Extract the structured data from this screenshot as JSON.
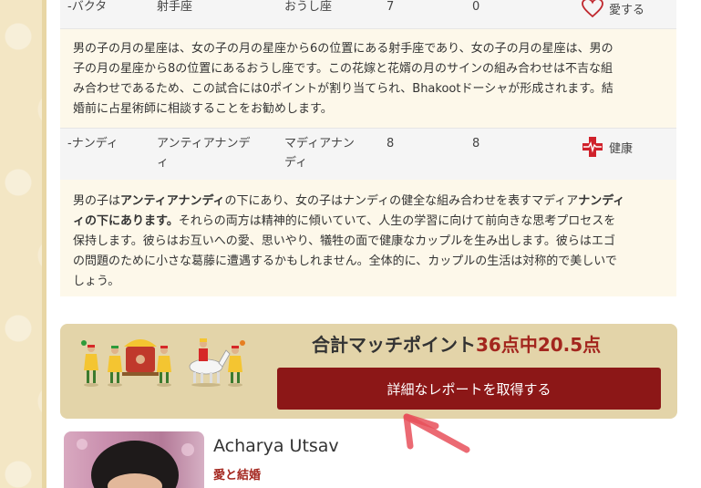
{
  "rows": [
    {
      "col1": "-バクタ",
      "col2": "射手座",
      "col3": "おうし座",
      "col4": "7",
      "col5": "0",
      "status_icon": "heart-outline-icon",
      "status_label": "愛する"
    },
    {
      "col1": "-ナンディ",
      "col2_line1": "アンティアナンデ",
      "col2_line2": "ィ",
      "col3_line1": "マディアナン",
      "col3_line2": "ディ",
      "col4": "8",
      "col5": "8",
      "status_icon": "health-cross-icon",
      "status_label": "健康"
    }
  ],
  "desc1": {
    "line1": "男の子の月の星座は、女の子の月の星座から6の位置にある射手座であり、女の子の月の星座は、男の",
    "line2": "子の月の星座から8の位置にあるおうし座です。この花嫁と花婿の月のサインの組み合わせは不吉な組",
    "line3": "み合わせであるため、この試合には0ポイントが割り当てられ、Bhakootドーシャが形成されます。結",
    "line4": "婚前に占星術師に相談することをお勧めします。"
  },
  "desc2": {
    "l1_a": "男の子は",
    "l1_b": "アンティアナンディ",
    "l1_c": "の下にあり、女の子はナンディの健全な組み合わせを表すマディア",
    "l1_d": "ナンディ",
    "l2_a": "ィの下にあります。",
    "l2_b": "それらの両方は精神的に傾いていて、人生の学習に向けて前向きな思考プロセスを",
    "line3": "保持します。彼らはお互いへの愛、思いやり、犠牲の面で健康なカップルを生み出します。彼らはエゴ",
    "line4": "の問題のために小さな葛藤に遭遇するかもしれません。全体的に、カップルの生活は対称的で美しいで",
    "line5": "しょう。"
  },
  "summary": {
    "total_label": "合計マッチポイント",
    "total_value": "36点中20.5点",
    "cta_label": "詳細なレポートを取得する"
  },
  "profile": {
    "name": "Acharya Utsav",
    "specialty": "愛と結婚"
  },
  "colors": {
    "accent_red": "#a3261e",
    "button_red": "#8c1717",
    "banner_bg": "#e3d4a9",
    "annotation_arrow": "#e8505b"
  }
}
